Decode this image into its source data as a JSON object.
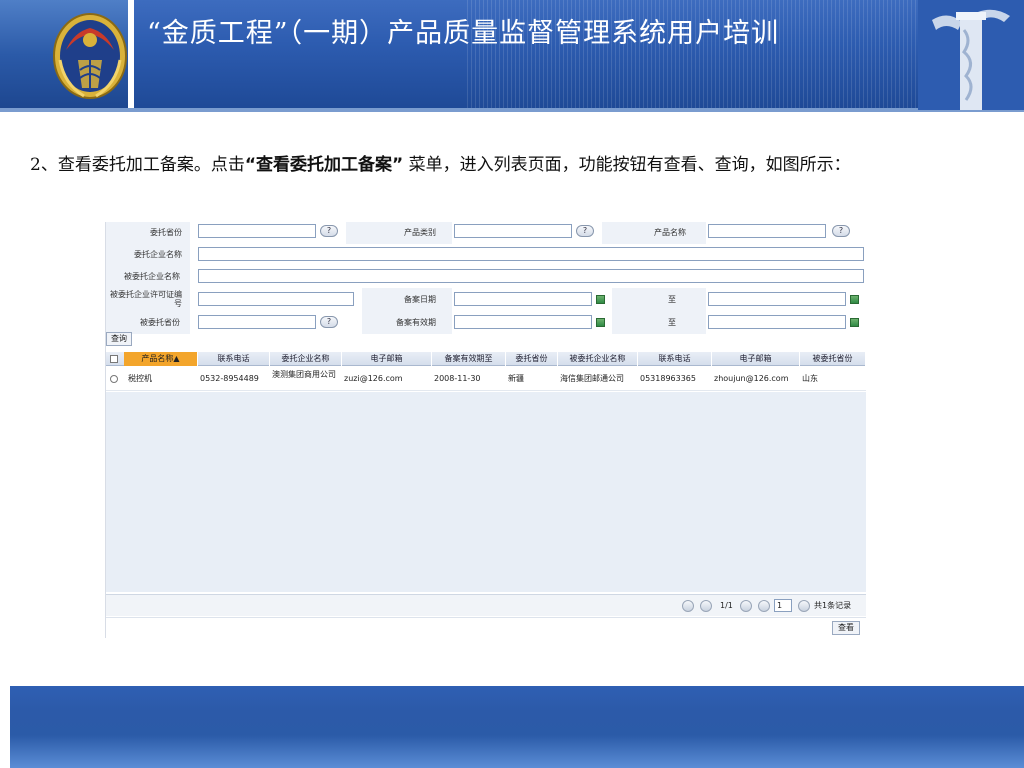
{
  "header": {
    "title": "“金质工程”（一期）产品质量监督管理系统用户培训"
  },
  "paragraph": {
    "prefix": "2、查看委托加工备案。点击",
    "quote": "“查看委托加工备案”",
    "suffix": " 菜单，进入列表页面，功能按钮有查看、查询，如图所示："
  },
  "form": {
    "row1": {
      "l1": "委托省份",
      "l2": "产品类别",
      "l3": "产品名称"
    },
    "row2": {
      "l1": "委托企业名称"
    },
    "row3": {
      "l1": "被委托企业名称"
    },
    "row4": {
      "l1": "被委托企业许可证编号",
      "l2": "备案日期",
      "l3": "至"
    },
    "row5": {
      "l1": "被委托省份",
      "l2": "备案有效期",
      "l3": "至"
    },
    "query_label": "查询",
    "help_glyph": "?"
  },
  "grid": {
    "columns": [
      "产品名称▲",
      "联系电话",
      "委托企业名称",
      "电子邮箱",
      "备案有效期至",
      "委托省份",
      "被委托企业名称",
      "联系电话",
      "电子邮箱",
      "被委托省份"
    ],
    "rows": [
      [
        "税控机",
        "0532-8954489",
        "澳测集团商用公司",
        "zuzi@126.com",
        "2008-11-30",
        "新疆",
        "海信集团邮通公司",
        "05318963365",
        "zhoujun@126.com",
        "山东"
      ]
    ]
  },
  "pager": {
    "page_text": "1/1",
    "page_input": "1",
    "total_text": "共1条记录"
  },
  "actions": {
    "view_label": "查看"
  },
  "colors": {
    "header_blue": "#2d5cb0",
    "footer_blue": "#2c5aa9",
    "sort_orange": "#f3a52b"
  }
}
